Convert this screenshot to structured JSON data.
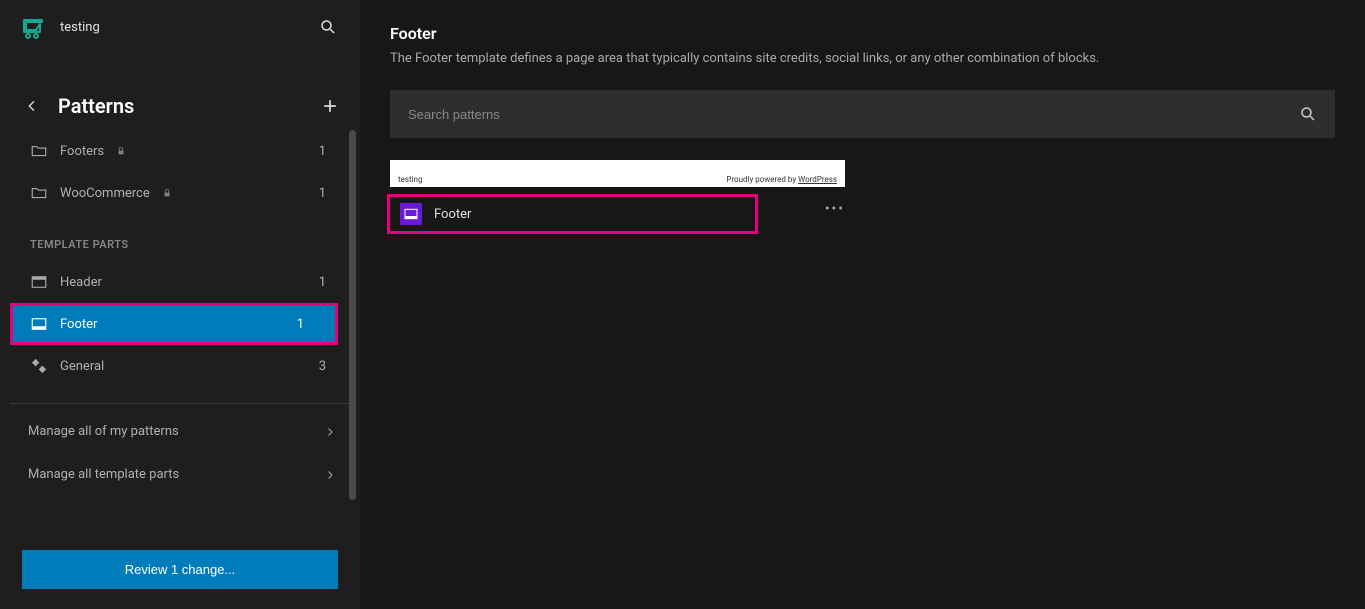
{
  "site": {
    "title": "testing"
  },
  "patterns_header": {
    "title": "Patterns"
  },
  "categories": [
    {
      "label": "Footers",
      "locked": true,
      "count": 1
    },
    {
      "label": "WooCommerce",
      "locked": true,
      "count": 1
    }
  ],
  "template_parts_label": "TEMPLATE PARTS",
  "template_parts": [
    {
      "label": "Header",
      "count": 1
    },
    {
      "label": "Footer",
      "count": 1
    },
    {
      "label": "General",
      "count": 3
    }
  ],
  "manage": {
    "my_patterns": "Manage all of my patterns",
    "template_parts": "Manage all template parts"
  },
  "review_button": "Review 1 change...",
  "main": {
    "title": "Footer",
    "description": "The Footer template defines a page area that typically contains site credits, social links, or any other combination of blocks.",
    "search_placeholder": "Search patterns"
  },
  "preview": {
    "left": "testing",
    "right_prefix": "Proudly powered by ",
    "right_link": "WordPress"
  },
  "card": {
    "title": "Footer"
  }
}
